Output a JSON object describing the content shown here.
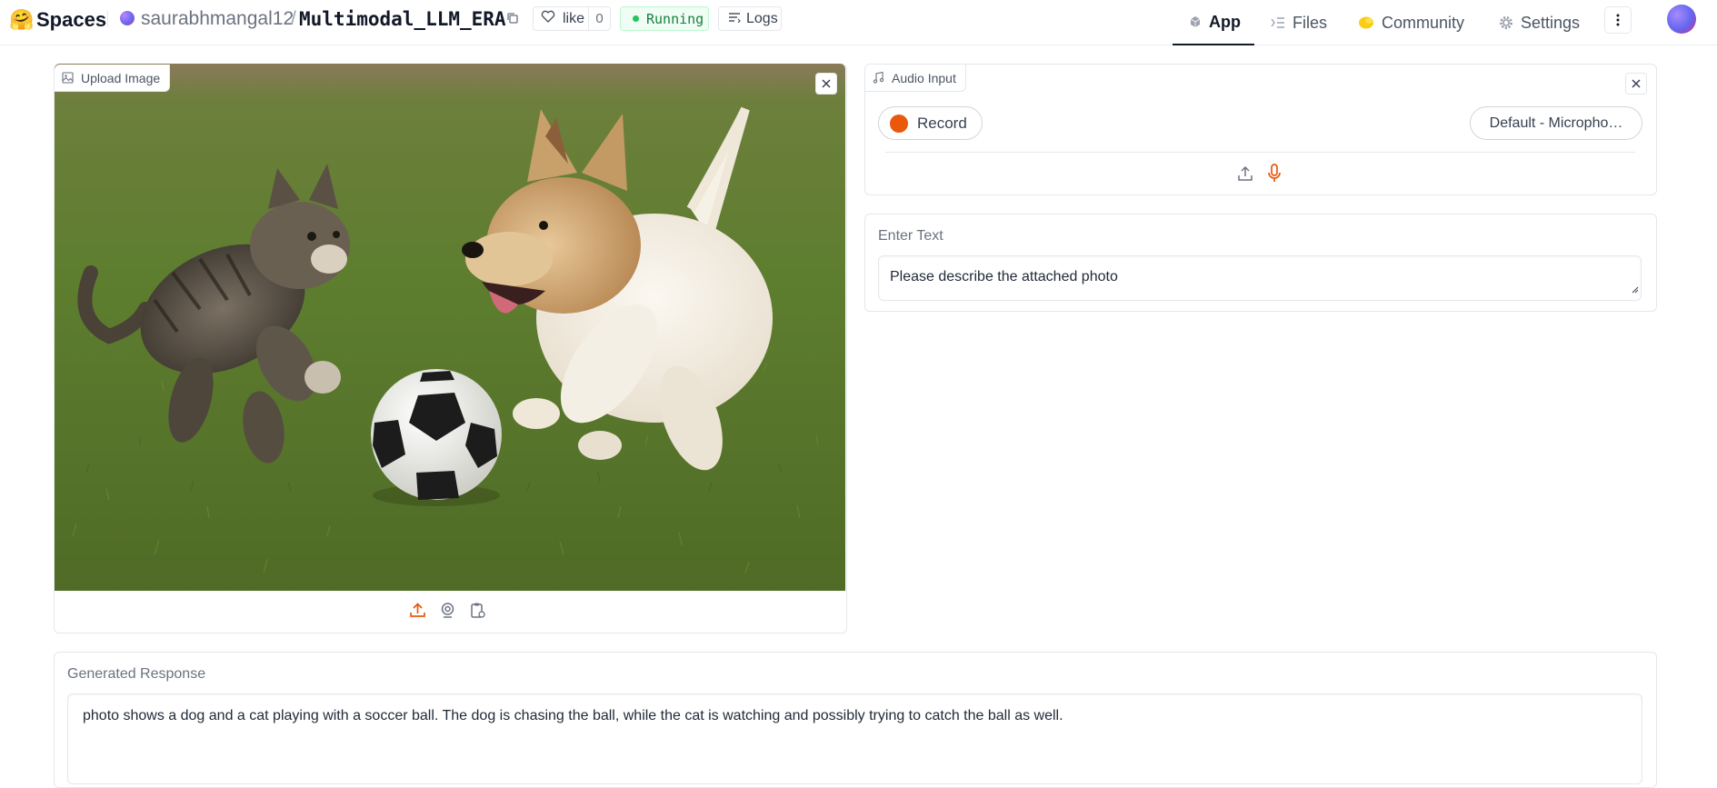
{
  "header": {
    "logo_emoji": "🤗",
    "brand": "Spaces",
    "owner": "saurabhmangal12",
    "separator": "/",
    "repo": "Multimodal_LLM_ERA",
    "like_label": "like",
    "like_count": "0",
    "status": "Running",
    "logs_label": "Logs",
    "tabs": [
      {
        "label": "App",
        "icon": "cube-icon",
        "active": true
      },
      {
        "label": "Files",
        "icon": "files-icon",
        "active": false
      },
      {
        "label": "Community",
        "icon": "community-icon",
        "active": false
      },
      {
        "label": "Settings",
        "icon": "gear-icon",
        "active": false
      }
    ]
  },
  "image_panel": {
    "label": "Upload Image",
    "tools": [
      "upload-icon",
      "webcam-icon",
      "clipboard-icon"
    ]
  },
  "audio_panel": {
    "label": "Audio Input",
    "record_label": "Record",
    "device_select": "Default - Micropho…",
    "tools": [
      "upload-icon",
      "microphone-icon"
    ]
  },
  "text_panel": {
    "title": "Enter Text",
    "value": "Please describe the attached photo"
  },
  "response_panel": {
    "title": "Generated Response",
    "value": "photo shows a dog and a cat playing with a soccer ball. The dog is chasing the ball, while the cat is watching and possibly trying to catch the ball as well."
  },
  "colors": {
    "accent": "#ea580c",
    "running_bg": "#f0fdf4",
    "running_text": "#15803d"
  }
}
